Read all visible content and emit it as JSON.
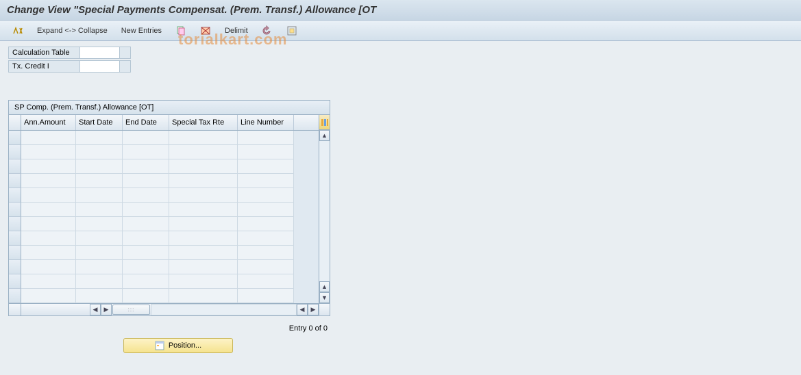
{
  "title": "Change View \"Special Payments Compensat. (Prem. Transf.) Allowance [OT",
  "toolbar": {
    "expand_collapse": "Expand <-> Collapse",
    "new_entries": "New Entries",
    "delimit": "Delimit"
  },
  "fields": {
    "calc_table_label": "Calculation Table",
    "tx_credit_label": "Tx. Credit I"
  },
  "table": {
    "title": "SP Comp. (Prem. Transf.) Allowance [OT]",
    "columns": {
      "ann_amount": "Ann.Amount",
      "start_date": "Start Date",
      "end_date": "End Date",
      "tax_rate": "Special Tax Rte",
      "line_number": "Line Number"
    }
  },
  "status": {
    "entry": "Entry 0 of 0"
  },
  "buttons": {
    "position": "Position..."
  },
  "watermark": "torialkart.com"
}
